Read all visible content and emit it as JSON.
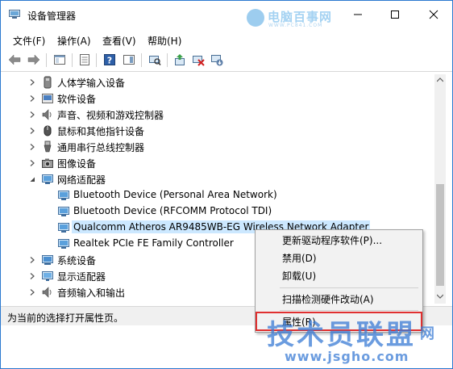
{
  "window": {
    "title": "设备管理器"
  },
  "watermark_top": {
    "text": "电脑百事网",
    "sub": "WWW.PC841.COM"
  },
  "menubar": {
    "items": [
      "文件(F)",
      "操作(A)",
      "查看(V)",
      "帮助(H)"
    ]
  },
  "tree": {
    "nodes": [
      {
        "label": "人体学输入设备",
        "expanded": false,
        "icon": "hid-icon"
      },
      {
        "label": "软件设备",
        "expanded": false,
        "icon": "software-device-icon"
      },
      {
        "label": "声音、视频和游戏控制器",
        "expanded": false,
        "icon": "speaker-icon"
      },
      {
        "label": "鼠标和其他指针设备",
        "expanded": false,
        "icon": "mouse-icon"
      },
      {
        "label": "通用串行总线控制器",
        "expanded": false,
        "icon": "usb-icon"
      },
      {
        "label": "图像设备",
        "expanded": false,
        "icon": "camera-icon"
      },
      {
        "label": "网络适配器",
        "expanded": true,
        "icon": "network-adapter-icon"
      },
      {
        "label": "Bluetooth Device (Personal Area Network)",
        "child": true,
        "icon": "network-adapter-icon"
      },
      {
        "label": "Bluetooth Device (RFCOMM Protocol TDI)",
        "child": true,
        "icon": "network-adapter-icon"
      },
      {
        "label": "Qualcomm Atheros AR9485WB-EG Wireless Network Adapter",
        "child": true,
        "selected": true,
        "icon": "network-adapter-icon"
      },
      {
        "label": "Realtek PCIe FE Family Controller",
        "child": true,
        "icon": "network-adapter-icon"
      },
      {
        "label": "系统设备",
        "expanded": false,
        "icon": "system-device-icon"
      },
      {
        "label": "显示适配器",
        "expanded": false,
        "icon": "display-adapter-icon"
      },
      {
        "label": "音频输入和输出",
        "expanded": false,
        "icon": "audio-io-icon"
      }
    ]
  },
  "context_menu": {
    "items": [
      {
        "label": "更新驱动程序软件(P)..."
      },
      {
        "label": "禁用(D)"
      },
      {
        "label": "卸载(U)"
      },
      {
        "label": "扫描检测硬件改动(A)"
      },
      {
        "label": "属性(R)"
      }
    ]
  },
  "statusbar": {
    "text": "为当前的选择打开属性页。"
  },
  "watermark_bottom": {
    "main": "技术员联盟",
    "net": "网",
    "url": "www.jsgho.com"
  },
  "colors": {
    "accent": "#2b79d0",
    "selection": "#cce8ff",
    "highlight_border": "#e03030",
    "watermark": "#3a7bd5"
  }
}
